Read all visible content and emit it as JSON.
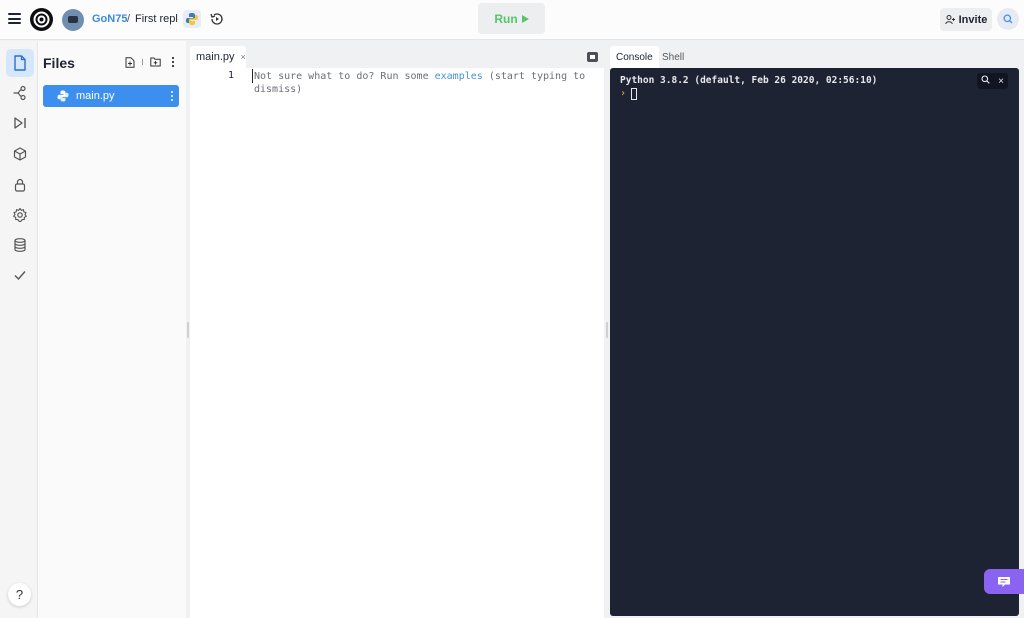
{
  "header": {
    "username": "GoN75",
    "separator": "/",
    "repl_name": "First repl",
    "language_icon": "python-icon",
    "run_label": "Run",
    "invite_label": "Invite"
  },
  "rail": {
    "items": [
      {
        "icon": "file-icon",
        "label": "Files",
        "active": true
      },
      {
        "icon": "version-control-icon",
        "label": "Version control"
      },
      {
        "icon": "debugger-icon",
        "label": "Debugger"
      },
      {
        "icon": "packages-icon",
        "label": "Packages"
      },
      {
        "icon": "lock-icon",
        "label": "Secrets"
      },
      {
        "icon": "gear-icon",
        "label": "Settings"
      },
      {
        "icon": "database-icon",
        "label": "Database"
      },
      {
        "icon": "check-icon",
        "label": "Unit tests"
      }
    ],
    "help_label": "?"
  },
  "files": {
    "title": "Files",
    "items": [
      {
        "name": "main.py",
        "selected": true
      }
    ]
  },
  "editor": {
    "tab_label": "main.py",
    "tab_close": "×",
    "line_numbers": [
      "1"
    ],
    "hint_before": "Not sure what to do? Run some ",
    "hint_link": "examples",
    "hint_after": " (start typing to dismiss)"
  },
  "console": {
    "tabs": [
      {
        "label": "Console",
        "active": true
      },
      {
        "label": "Shell",
        "active": false
      }
    ],
    "banner": "Python 3.8.2 (default, Feb 26 2020, 02:56:10)",
    "prompt": "›",
    "close_label": "×"
  },
  "colors": {
    "accent": "#3d8fef",
    "run_green": "#58c46a",
    "console_bg": "#1d2333",
    "chat_purple": "#8a63f0"
  }
}
